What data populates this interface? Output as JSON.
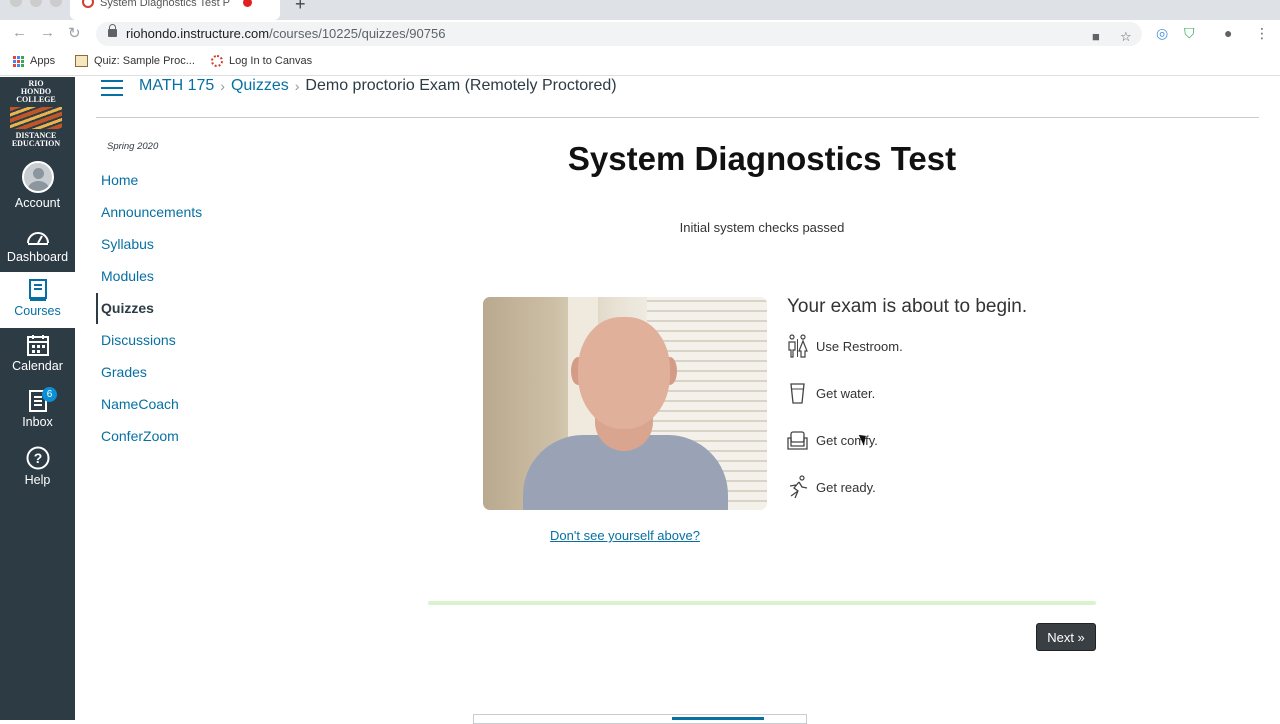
{
  "browser": {
    "tab_title": "System Diagnostics Test P",
    "tab_close": "×",
    "new_tab": "+",
    "url_host": "riohondo.instructure.com",
    "url_path": "/courses/10225/quizzes/90756",
    "bookmarks": [
      {
        "label": "Apps",
        "icon": "apps-grid-icon"
      },
      {
        "label": "Quiz: Sample Proc...",
        "icon": "image-icon"
      },
      {
        "label": "Log In to Canvas",
        "icon": "canvas-icon"
      }
    ]
  },
  "global_nav": {
    "logo_lines": [
      "RIO",
      "HONDO",
      "COLLEGE",
      "DISTANCE",
      "EDUCATION"
    ],
    "items": [
      {
        "label": "Account",
        "icon": "account-avatar-icon"
      },
      {
        "label": "Dashboard",
        "icon": "dashboard-icon"
      },
      {
        "label": "Courses",
        "icon": "courses-icon",
        "active": true
      },
      {
        "label": "Calendar",
        "icon": "calendar-icon"
      },
      {
        "label": "Inbox",
        "icon": "inbox-icon",
        "badge": "6"
      },
      {
        "label": "Help",
        "icon": "help-icon"
      }
    ]
  },
  "breadcrumb": {
    "course": "MATH 175",
    "section": "Quizzes",
    "current": "Demo proctorio Exam (Remotely Proctored)",
    "separator": "›"
  },
  "course_nav": {
    "term": "Spring 2020",
    "items": [
      "Home",
      "Announcements",
      "Syllabus",
      "Modules",
      "Quizzes",
      "Discussions",
      "Grades",
      "NameCoach",
      "ConferZoom"
    ],
    "active": "Quizzes"
  },
  "diagnostic": {
    "title": "System Diagnostics Test",
    "status": "Initial system checks passed",
    "dont_see": "Don't see yourself above?",
    "ready_title": "Your exam is about to begin.",
    "steps": [
      {
        "label": "Use Restroom.",
        "icon": "restroom-icon"
      },
      {
        "label": "Get water.",
        "icon": "water-glass-icon"
      },
      {
        "label": "Get comfy.",
        "icon": "armchair-icon"
      },
      {
        "label": "Get ready.",
        "icon": "runner-icon"
      }
    ],
    "next_label": "Next »"
  },
  "colors": {
    "canvas_nav": "#2d3b45",
    "link": "#0770a3",
    "progress": "#d9f3cc",
    "next_button": "#3a3f44"
  }
}
